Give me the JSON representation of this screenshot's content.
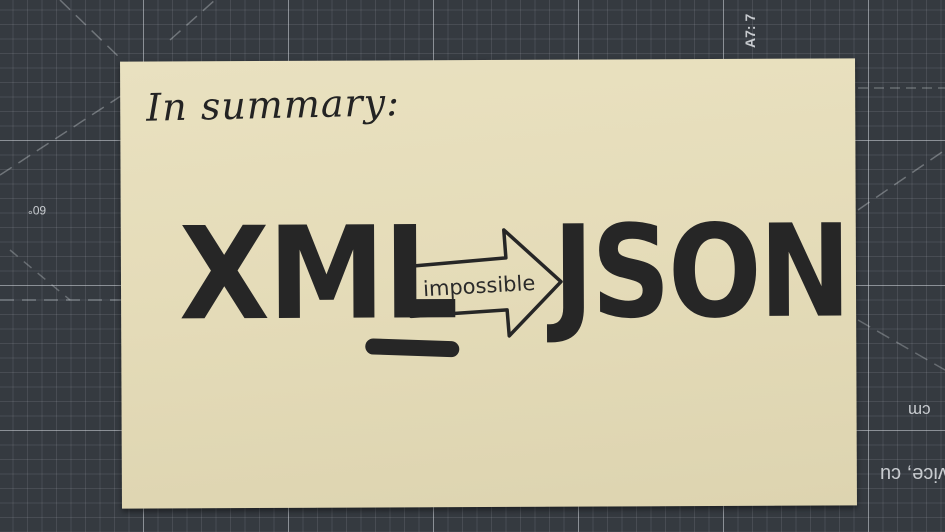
{
  "card": {
    "heading": "In summary:",
    "left_word": "XML",
    "arrow_label": "impossible",
    "right_word": "JSON"
  },
  "mat_text": {
    "corner_label": "A7: 7",
    "angle_label": "60°",
    "unit_label": "cm",
    "edge_text": "vice, cu"
  },
  "colors": {
    "mat": "#353a40",
    "grid": "#dce1e6",
    "paper": "#e6ddbb",
    "ink": "#242424"
  }
}
